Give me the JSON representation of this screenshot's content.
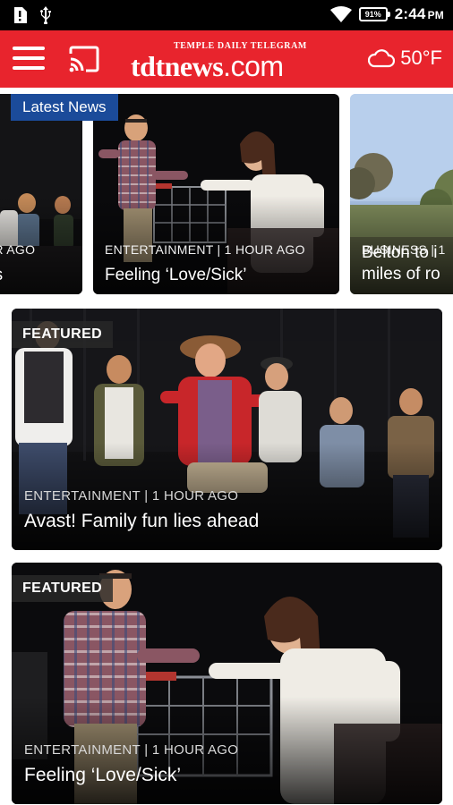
{
  "status_bar": {
    "time": "2:44",
    "ampm": "PM",
    "battery": "91%",
    "icons": [
      "alert-icon",
      "usb-icon",
      "wifi-icon",
      "battery-icon"
    ]
  },
  "header": {
    "logo_tagline": "TEMPLE DAILY TELEGRAM",
    "logo_main": "tdtnews",
    "logo_domain": ".com",
    "weather_temp": "50°F",
    "icons": [
      "menu-icon",
      "cast-icon",
      "cloud-icon"
    ],
    "colors": {
      "brand": "#e8242d",
      "badge": "#1b4b9a"
    }
  },
  "carousel": {
    "badge": "Latest News",
    "cards": [
      {
        "meta": "UR AGO",
        "headline": "es"
      },
      {
        "meta": "ENTERTAINMENT | 1 HOUR AGO",
        "headline": "Feeling ‘Love/Sick’"
      },
      {
        "meta": "BUSINESS | 1",
        "headline": "Belton to i miles of ro"
      }
    ]
  },
  "featured": [
    {
      "badge": "FEATURED",
      "meta": "ENTERTAINMENT | 1 HOUR AGO",
      "headline": "Avast! Family fun lies ahead"
    },
    {
      "badge": "FEATURED",
      "meta": "ENTERTAINMENT | 1 HOUR AGO",
      "headline": "Feeling ‘Love/Sick’"
    }
  ]
}
